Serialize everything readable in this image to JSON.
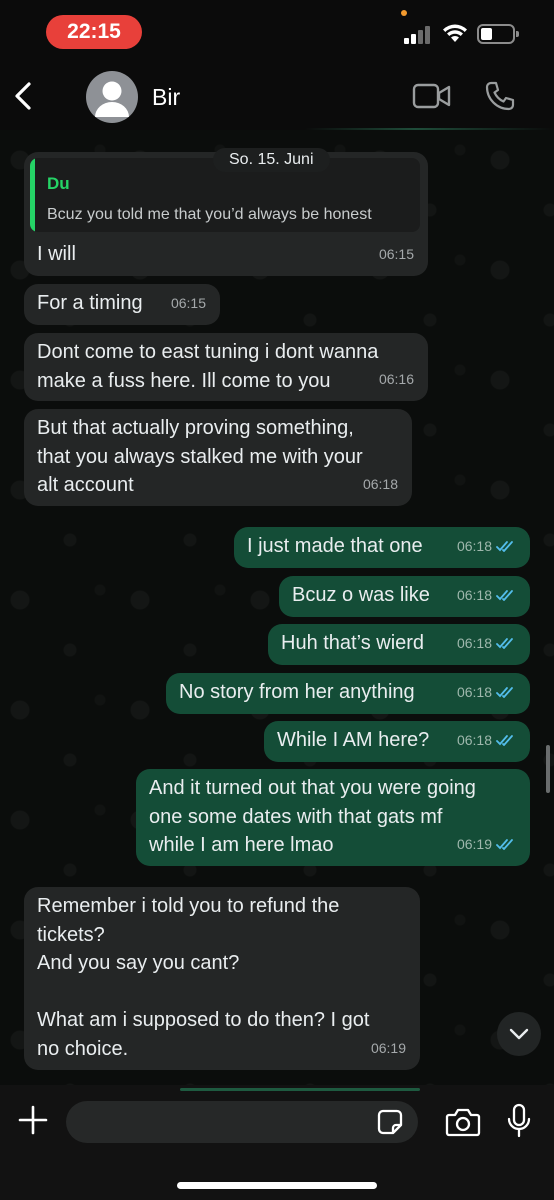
{
  "status_bar": {
    "time": "22:15"
  },
  "header": {
    "contact_name": "Bir",
    "icons": [
      "back-chevron-icon",
      "avatar-icon",
      "video-call-icon",
      "phone-icon"
    ]
  },
  "date_chip": "So. 15. Juni",
  "messages": [
    {
      "dir": "in",
      "quote_author": "Du",
      "quote_text": "Bcuz you told me that you’d always be honest",
      "text": "I will",
      "time": "06:15"
    },
    {
      "dir": "in",
      "text": "For a timing",
      "time": "06:15"
    },
    {
      "dir": "in",
      "text": "Dont come to east tuning i dont wanna\nmake a fuss here. Ill come to you",
      "time": "06:16"
    },
    {
      "dir": "in",
      "text": "But that actually proving something,\nthat you always stalked me with your\nalt account",
      "time": "06:18"
    },
    {
      "dir": "out",
      "text": "I just made that one",
      "time": "06:18",
      "read": true
    },
    {
      "dir": "out",
      "text": "Bcuz o was like",
      "time": "06:18",
      "read": true
    },
    {
      "dir": "out",
      "text": "Huh that’s wierd",
      "time": "06:18",
      "read": true
    },
    {
      "dir": "out",
      "text": "No story from her anything",
      "time": "06:18",
      "read": true
    },
    {
      "dir": "out",
      "text": "While I AM here?",
      "time": "06:18",
      "read": true
    },
    {
      "dir": "out",
      "text": "And it turned out that you were going\none some dates with that gats mf\nwhile I am here lmao",
      "time": "06:19",
      "read": true
    },
    {
      "dir": "in",
      "text": "Remember i told you to refund the\ntickets?\nAnd you say you cant?\n\nWhat am i supposed to do then? I got\nno choice.",
      "time": "06:19"
    }
  ],
  "input": {
    "placeholder": "",
    "value": ""
  },
  "colors": {
    "incoming_bubble": "#242626",
    "outgoing_bubble": "#144d37",
    "accent_green": "#25d366",
    "read_ticks": "#53bdeb",
    "time_pill": "#e8403a"
  }
}
